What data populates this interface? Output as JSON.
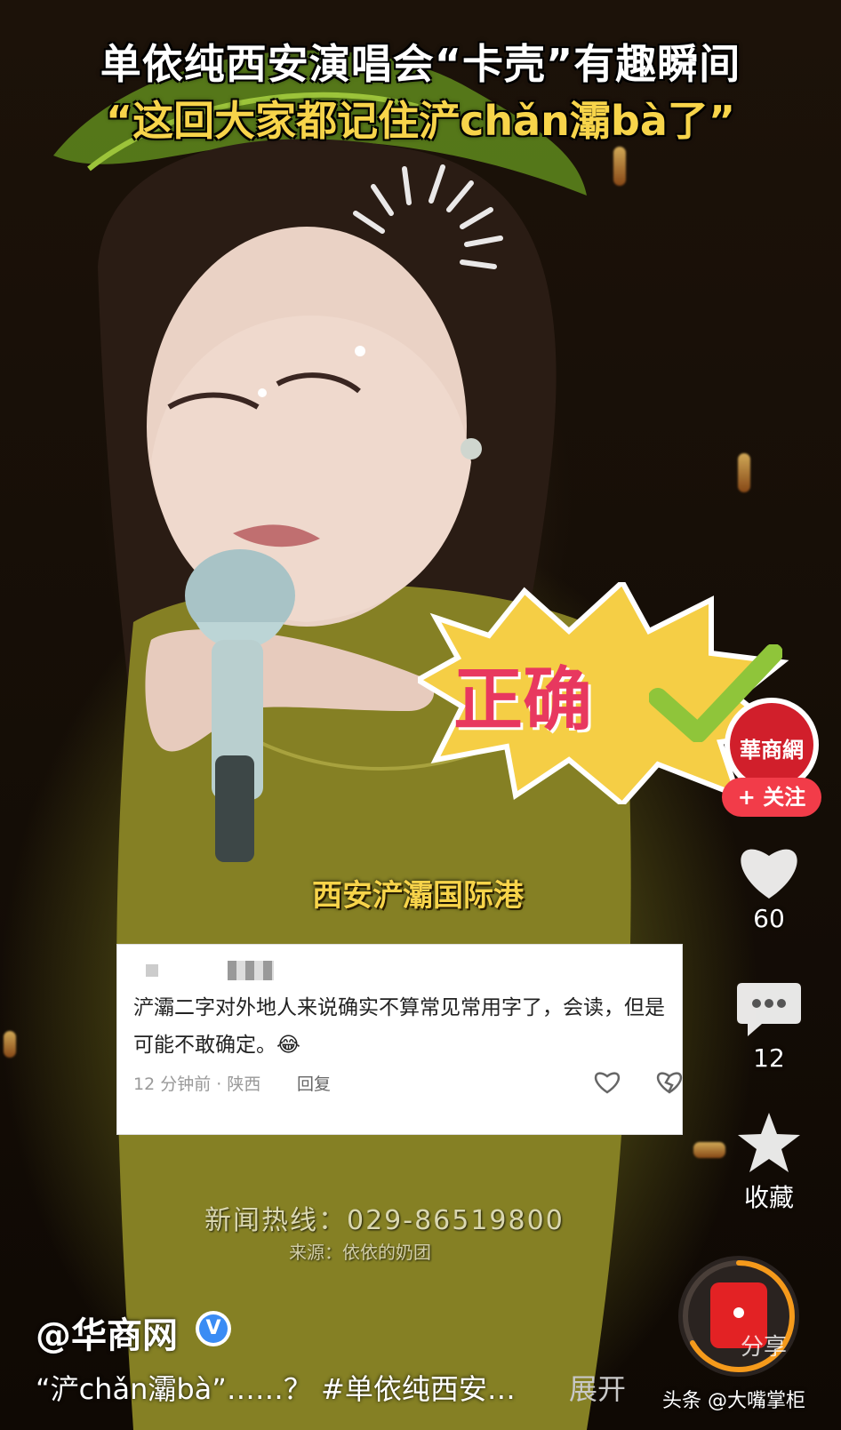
{
  "video": {
    "title_line1": "单依纯西安演唱会“卡壳”有趣瞬间",
    "title_line2": "“这回大家都记住浐chǎn灞bà了”",
    "badge_text": "正确",
    "location_caption": "西安浐灞国际港",
    "hotline": "新闻热线：029-86519800",
    "source": "来源：依依的奶团"
  },
  "comment": {
    "text": "浐灞二字对外地人来说确实不算常见常用字了，会读，但是可能不敢确定。😂",
    "meta": "12 分钟前 · 陕西",
    "reply_label": "回复"
  },
  "rail": {
    "avatar_logo": "華商網",
    "follow_label": "+ 关注",
    "likes": "60",
    "comments": "12",
    "favorite_label": "收藏",
    "share_label": "分享"
  },
  "author": {
    "name": "@华商网",
    "verified_label": "V"
  },
  "caption": {
    "text": "“浐chǎn灞bà”……？ #单依纯西安…",
    "expand_label": "展开"
  },
  "footer": {
    "tag": "头条 @大嘴掌柜"
  },
  "colors": {
    "title_yellow": "#f7d44a",
    "badge_red": "#e8385f",
    "follow_red": "#f23c49",
    "verified_blue": "#3a8cf4"
  },
  "icons": [
    "heart-icon",
    "comment-icon",
    "star-icon",
    "red-packet-icon",
    "verified-icon",
    "like-icon",
    "dislike-icon"
  ]
}
